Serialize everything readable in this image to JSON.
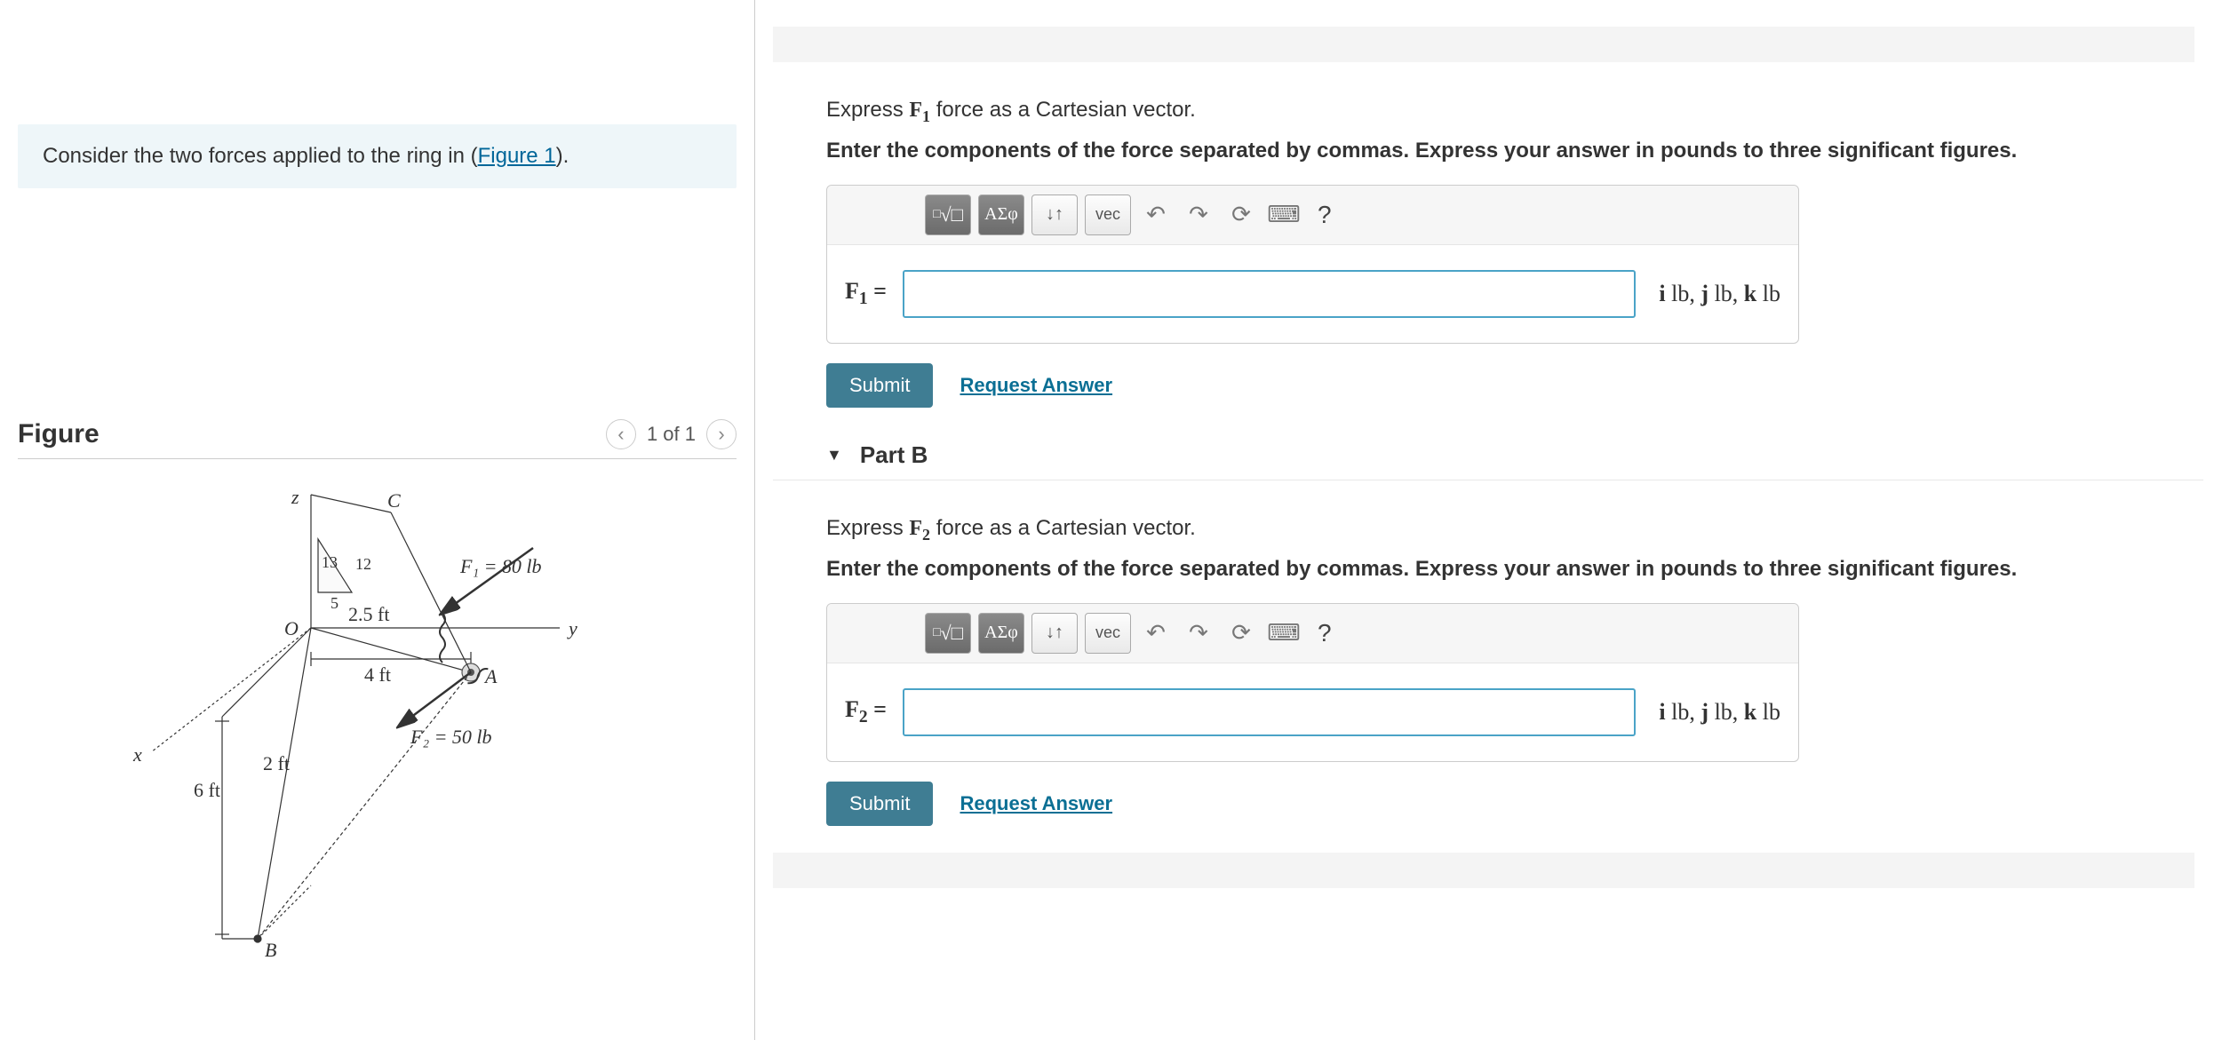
{
  "left": {
    "intro_prefix": "Consider the two forces applied to the ring in (",
    "intro_link": "Figure 1",
    "intro_suffix": ").",
    "figure_title": "Figure",
    "figure_counter": "1 of 1",
    "diagram": {
      "axis_z": "z",
      "axis_y": "y",
      "axis_x": "x",
      "point_O": "O",
      "point_A": "A",
      "point_B": "B",
      "point_C": "C",
      "tri_hyp": "13",
      "tri_vert": "12",
      "tri_base": "5",
      "dim_2_5ft": "2.5 ft",
      "dim_4ft": "4 ft",
      "dim_2ft": "2 ft",
      "dim_6ft": "6 ft",
      "F1_label": "F₁ = 80 lb",
      "F2_label": "F₂ = 50 lb"
    }
  },
  "right": {
    "partA": {
      "prompt_prefix": "Express ",
      "prompt_var": "F",
      "prompt_sub": "1",
      "prompt_suffix": " force as a Cartesian vector.",
      "prompt_bold": "Enter the components of the force separated by commas. Express your answer in pounds to three significant figures.",
      "toolbar_greek": "ΑΣφ",
      "toolbar_vec": "vec",
      "label_var": "F",
      "label_sub": "1",
      "label_eq": " =",
      "units_text": "i lb, j lb, k lb",
      "submit": "Submit",
      "request": "Request Answer"
    },
    "partB": {
      "header": "Part B",
      "prompt_prefix": "Express ",
      "prompt_var": "F",
      "prompt_sub": "2",
      "prompt_suffix": " force as a Cartesian vector.",
      "prompt_bold": "Enter the components of the force separated by commas. Express your answer in pounds to three significant figures.",
      "toolbar_greek": "ΑΣφ",
      "toolbar_vec": "vec",
      "label_var": "F",
      "label_sub": "2",
      "label_eq": " =",
      "units_text": "i lb, j lb, k lb",
      "submit": "Submit",
      "request": "Request Answer"
    }
  }
}
